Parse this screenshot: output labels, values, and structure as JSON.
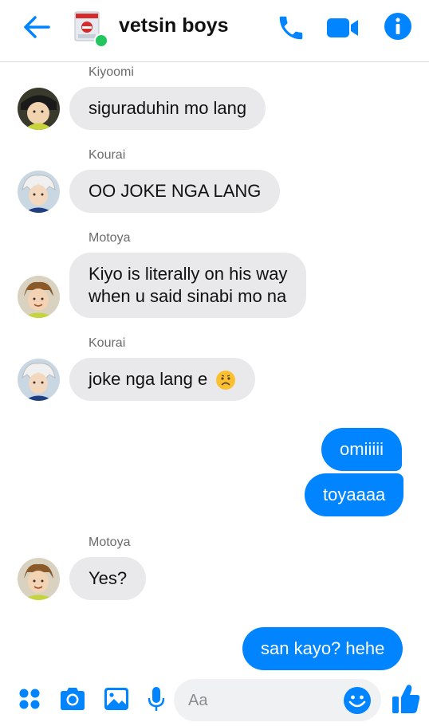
{
  "header": {
    "title": "vetsin boys",
    "online_color": "#22c55e"
  },
  "messages": [
    {
      "sender": "Kiyoomi",
      "text": "siguraduhin mo lang"
    },
    {
      "sender": "Kourai",
      "text": "OO JOKE NGA LANG"
    },
    {
      "sender": "Motoya",
      "line1": "Kiyo is literally on his way",
      "line2": "when u said sinabi mo na"
    },
    {
      "sender": "Kourai",
      "text": "joke nga lang e",
      "emoji": "worried-face"
    },
    {
      "out1": "omiiiii",
      "out2": "toyaaaa"
    },
    {
      "sender": "Motoya",
      "text": "Yes?"
    },
    {
      "out": "san kayo? hehe"
    }
  ],
  "composer": {
    "placeholder": "Aa"
  },
  "colors": {
    "accent": "#0084ff",
    "incoming_bubble": "#e9e9eb"
  }
}
